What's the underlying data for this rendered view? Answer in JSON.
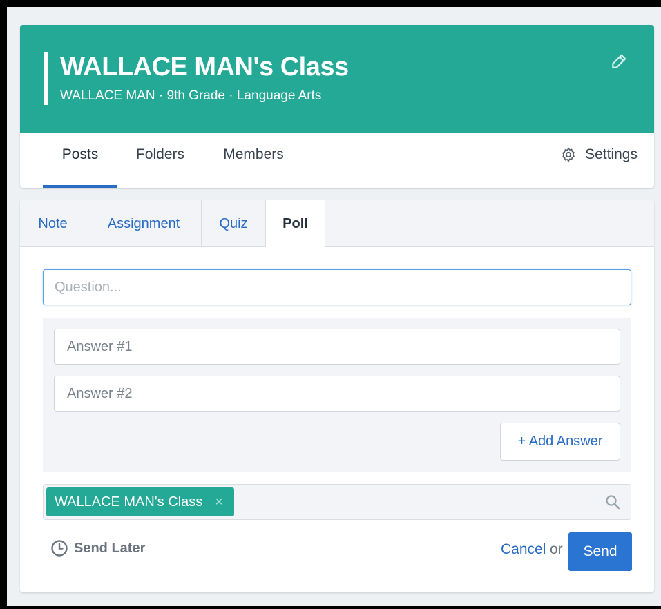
{
  "header": {
    "class_title": "WALLACE MAN's Class",
    "subtitle": "WALLACE MAN · 9th Grade · Language Arts",
    "edit_icon": "pencil-icon",
    "banner_color": "#23a996"
  },
  "nav": {
    "tabs": [
      {
        "label": "Posts",
        "active": true
      },
      {
        "label": "Folders",
        "active": false
      },
      {
        "label": "Members",
        "active": false
      }
    ],
    "settings_label": "Settings",
    "settings_icon": "gear-icon"
  },
  "composer": {
    "type_tabs": [
      {
        "label": "Note",
        "active": false
      },
      {
        "label": "Assignment",
        "active": false
      },
      {
        "label": "Quiz",
        "active": false
      },
      {
        "label": "Poll",
        "active": true
      }
    ],
    "question_placeholder": "Question...",
    "answers": [
      {
        "placeholder": "Answer #1"
      },
      {
        "placeholder": "Answer #2"
      }
    ],
    "add_answer_label": "+ Add Answer",
    "recipient_chip": "WALLACE MAN's Class",
    "recipient_remove": "×",
    "send_later_label": "Send Later",
    "cancel_label": "Cancel",
    "or_label": "or",
    "send_label": "Send",
    "accent_color": "#2a74d2"
  }
}
